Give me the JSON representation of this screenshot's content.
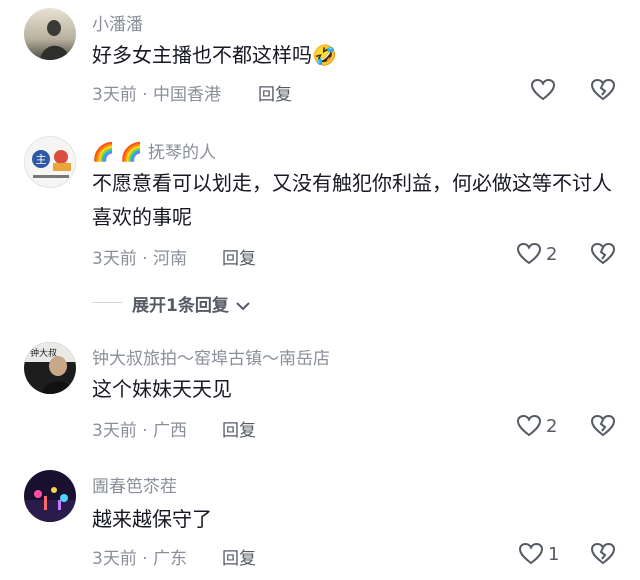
{
  "comments": [
    {
      "username": "小潘潘",
      "text": "好多女主播也不都这样吗🤣",
      "time": "3天前",
      "location": "中国香港",
      "reply_label": "回复",
      "likes": ""
    },
    {
      "username_emoji": "🌈 🌈",
      "username": "抚琴的人",
      "text": "不愿意看可以划走，又没有触犯你利益，何必做这等不讨人喜欢的事呢",
      "time": "3天前",
      "location": "河南",
      "reply_label": "回复",
      "likes": "2"
    },
    {
      "username": "钟大叔旅拍～窑埠古镇～南岳店",
      "text": "这个妹妹天天见",
      "time": "3天前",
      "location": "广西",
      "reply_label": "回复",
      "likes": "2"
    },
    {
      "username": "圊春笆苶茬",
      "text": "越来越保守了",
      "time": "3天前",
      "location": "广东",
      "reply_label": "回复",
      "likes": "1"
    }
  ],
  "expand_replies": "展开1条回复",
  "separator": "·",
  "avatar_text": {
    "c2_top": "主",
    "c3_name": "钟大叔"
  },
  "colors": {
    "text": "#161823",
    "secondary": "#8a8f99",
    "action": "#555a64"
  }
}
